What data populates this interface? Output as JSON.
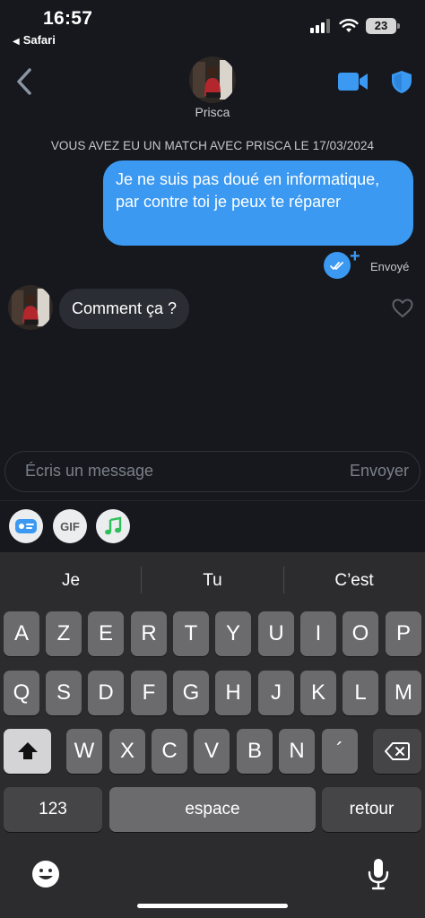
{
  "status": {
    "time": "16:57",
    "back_app": "Safari",
    "battery": "23"
  },
  "header": {
    "contact_name": "Prisca"
  },
  "match_banner": "VOUS AVEZ EU UN MATCH AVEC PRISCA LE 17/03/2024",
  "messages": [
    {
      "direction": "outgoing",
      "text": "Je ne suis pas doué en informatique, par contre toi je peux te réparer",
      "status": "Envoyé"
    },
    {
      "direction": "incoming",
      "text": "Comment ça ?"
    }
  ],
  "composer": {
    "placeholder": "Écris un message",
    "send_label": "Envoyer"
  },
  "tools": {
    "gif_label": "GIF"
  },
  "keyboard": {
    "suggestions": [
      "Je",
      "Tu",
      "C’est"
    ],
    "row1": [
      "A",
      "Z",
      "E",
      "R",
      "T",
      "Y",
      "U",
      "I",
      "O",
      "P"
    ],
    "row2": [
      "Q",
      "S",
      "D",
      "F",
      "G",
      "H",
      "J",
      "K",
      "L",
      "M"
    ],
    "row3": [
      "W",
      "X",
      "C",
      "V",
      "B",
      "N",
      "´"
    ],
    "numbers_label": "123",
    "space_label": "espace",
    "return_label": "retour"
  },
  "colors": {
    "accent": "#3b99f2",
    "background": "#16181d",
    "incoming_bubble": "#2a2d33"
  }
}
